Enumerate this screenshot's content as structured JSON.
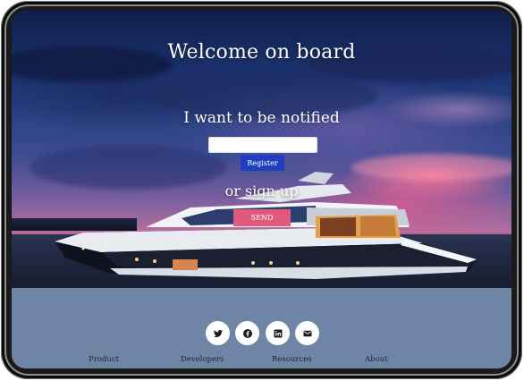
{
  "hero": {
    "title": "Welcome on board",
    "notify_heading": "I want to be notified",
    "email_value": "",
    "register_label": "Register",
    "signup_heading": "or sign up",
    "send_label": "SEND"
  },
  "footer": {
    "social": [
      "twitter-icon",
      "facebook-icon",
      "linkedin-icon",
      "email-icon"
    ],
    "links": [
      "Product",
      "Developers",
      "Resources",
      "About"
    ]
  },
  "colors": {
    "footer_bg": "#6e85a6",
    "register_bg": "#1f3fbf",
    "send_bg": "#e05a7e"
  }
}
